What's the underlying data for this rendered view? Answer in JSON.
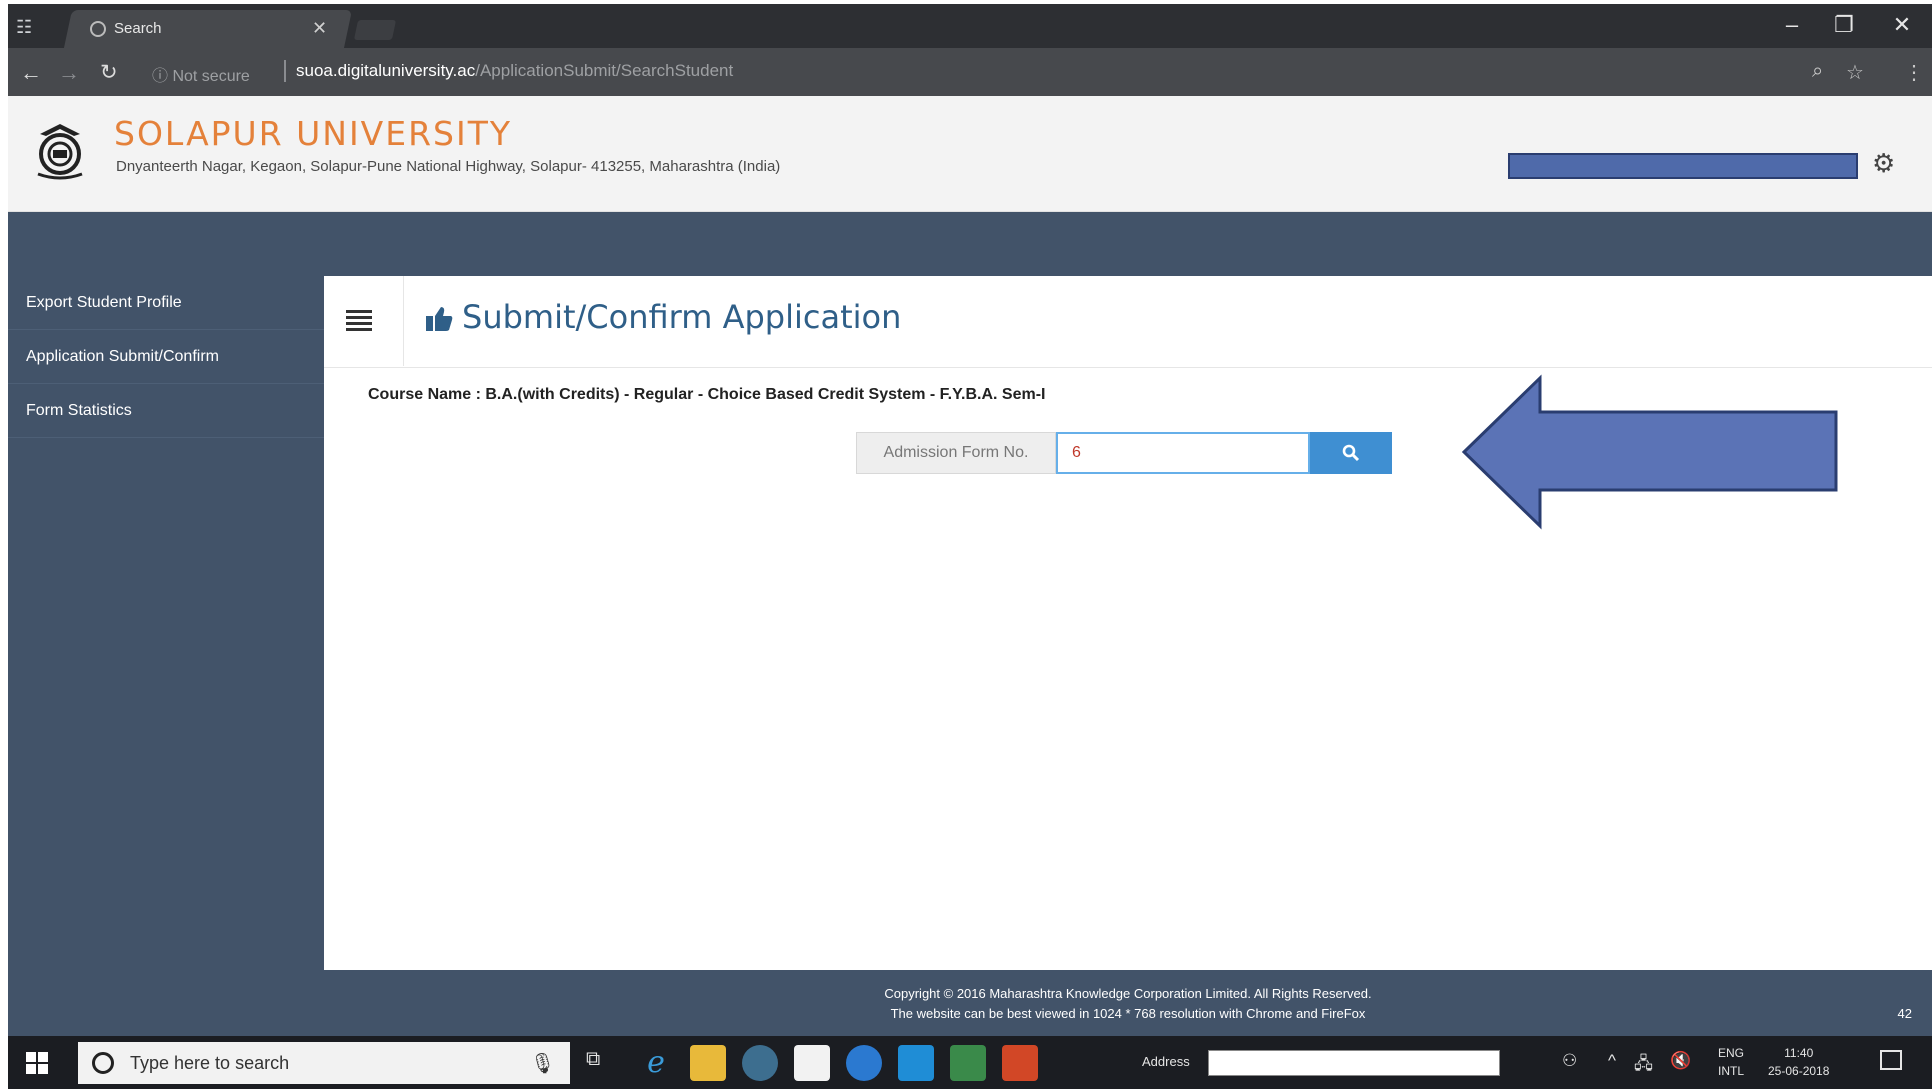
{
  "browser": {
    "tab_title": "Search",
    "url_security": "ⓘ Not secure",
    "url_host": "suoa.digitaluniversity.ac",
    "url_path": "/ApplicationSubmit/SearchStudent"
  },
  "header": {
    "university_name": "SOLAPUR UNIVERSITY",
    "address": "Dnyanteerth Nagar, Kegaon, Solapur-Pune National Highway, Solapur- 413255, Maharashtra (India)"
  },
  "sidebar": {
    "items": [
      {
        "label": "Export Student Profile"
      },
      {
        "label": "Application Submit/Confirm"
      },
      {
        "label": "Form Statistics"
      }
    ]
  },
  "main": {
    "page_title": "Submit/Confirm Application",
    "course_name": "Course Name : B.A.(with Credits) - Regular - Choice Based Credit System - F.Y.B.A. Sem-I",
    "search": {
      "label": "Admission Form No.",
      "value": "6"
    }
  },
  "footer": {
    "line1": "Copyright © 2016 Maharashtra Knowledge Corporation Limited. All Rights Reserved.",
    "line2": "The website can be best viewed in 1024 * 768 resolution with Chrome and FireFox",
    "count": "42"
  },
  "taskbar": {
    "search_placeholder": "Type here to search",
    "address_label": "Address",
    "lang_line1": "ENG",
    "lang_line2": "INTL",
    "time": "11:40",
    "date": "25-06-2018"
  },
  "colors": {
    "brand_orange": "#e4813a",
    "nav_slate": "#425369",
    "title_blue": "#2f5f88",
    "search_button": "#3f8fd2",
    "arrow_fill": "#5b73b6"
  }
}
